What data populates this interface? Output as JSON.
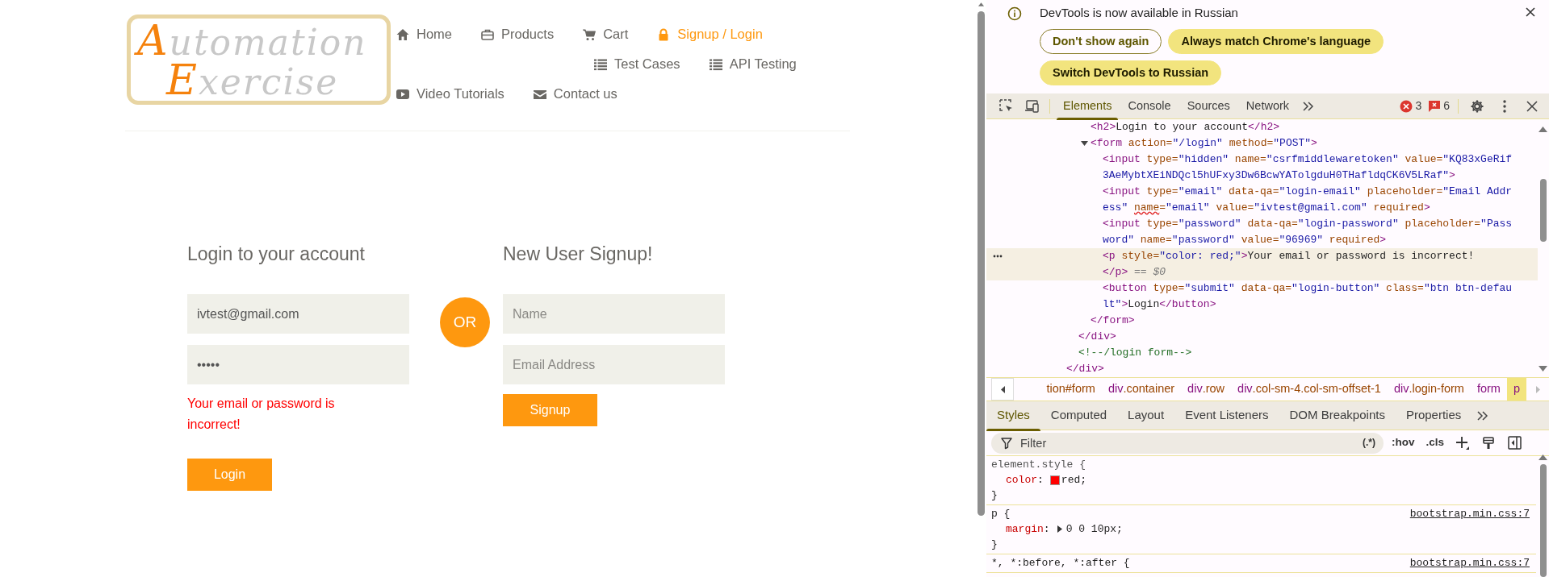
{
  "page": {
    "logo": {
      "line_1": "Automation",
      "line_2": "Exercise"
    },
    "nav": [
      {
        "label": "Home",
        "selected": false
      },
      {
        "label": "Products",
        "selected": false
      },
      {
        "label": "Cart",
        "selected": false
      },
      {
        "label": "Signup / Login",
        "selected": true
      },
      {
        "label": "Test Cases",
        "selected": false
      },
      {
        "label": "API Testing",
        "selected": false
      },
      {
        "label": "Video Tutorials",
        "selected": false
      },
      {
        "label": "Contact us",
        "selected": false
      }
    ],
    "login_form": {
      "title": "Login to your account",
      "fields": [
        {
          "value": "ivtest@gmail.com"
        },
        {
          "value": "•••••"
        }
      ],
      "error": "Your email or password is incorrect!",
      "button": "Login"
    },
    "divider_label": "OR",
    "signup_form": {
      "title": "New User Signup!",
      "fields": [
        {
          "placeholder": "Name"
        },
        {
          "placeholder": "Email Address"
        }
      ],
      "button": "Signup"
    }
  },
  "devtools": {
    "notification": {
      "message": "DevTools is now available in Russian",
      "buttons": [
        {
          "label": "Don't show again",
          "kind": "outline"
        },
        {
          "label": "Always match Chrome's language",
          "kind": "filled"
        },
        {
          "label": "Switch DevTools to Russian",
          "kind": "filled"
        }
      ]
    },
    "tabs": [
      {
        "label": "Elements",
        "selected": true
      },
      {
        "label": "Console",
        "selected": false
      },
      {
        "label": "Sources",
        "selected": false
      },
      {
        "label": "Network",
        "selected": false
      }
    ],
    "counters": {
      "errors": "3",
      "warnings": "6"
    },
    "dom_tree": [
      {
        "closing": [
          {
            "kind": "tag",
            "text": "</div>"
          }
        ],
        "children": [
          {
            "closing": [
              {
                "kind": "tag",
                "text": "</div>"
              }
            ],
            "children": [
              {
                "lines": [
                  [
                    {
                      "kind": "tag",
                      "text": "<h2>"
                    },
                    {
                      "kind": "text",
                      "text": "Login to your account"
                    },
                    {
                      "kind": "tag",
                      "text": "</h2>"
                    }
                  ]
                ]
              },
              {
                "expanded": true,
                "lines": [
                  [
                    {
                      "kind": "tag",
                      "text": "<form"
                    },
                    {
                      "kind": "attr",
                      "text": " action="
                    },
                    {
                      "kind": "value",
                      "text": "\"/login\""
                    },
                    {
                      "kind": "attr",
                      "text": " method="
                    },
                    {
                      "kind": "value",
                      "text": "\"POST\""
                    },
                    {
                      "kind": "tag",
                      "text": ">"
                    }
                  ]
                ],
                "closing": [
                  {
                    "kind": "tag",
                    "text": "</form>"
                  }
                ],
                "children": [
                  {
                    "lines": [
                      [
                        {
                          "kind": "tag",
                          "text": "<input"
                        },
                        {
                          "kind": "attr",
                          "text": " type="
                        },
                        {
                          "kind": "value",
                          "text": "\"hidden\""
                        },
                        {
                          "kind": "attr",
                          "text": " name="
                        },
                        {
                          "kind": "value",
                          "text": "\"csrfmiddlewaretoken\""
                        },
                        {
                          "kind": "attr",
                          "text": " value="
                        },
                        {
                          "kind": "value",
                          "text": "\"KQ83xGeRif"
                        }
                      ],
                      [
                        {
                          "kind": "value",
                          "text": "3AeMybtXEiNDQcl5hUFxy3Dw6BcwYATolgduH0THafldqCK6V5LRaf\""
                        },
                        {
                          "kind": "tag",
                          "text": ">"
                        }
                      ]
                    ]
                  },
                  {
                    "lines": [
                      [
                        {
                          "kind": "tag",
                          "text": "<input"
                        },
                        {
                          "kind": "attr",
                          "text": " type="
                        },
                        {
                          "kind": "value",
                          "text": "\"email\""
                        },
                        {
                          "kind": "attr",
                          "text": " data-qa="
                        },
                        {
                          "kind": "value",
                          "text": "\"login-email\""
                        },
                        {
                          "kind": "attr",
                          "text": " placeholder="
                        },
                        {
                          "kind": "value",
                          "text": "\"Email Addr"
                        }
                      ],
                      [
                        {
                          "kind": "value",
                          "text": "ess\" "
                        },
                        {
                          "kind": "flagged",
                          "text": "name"
                        },
                        {
                          "kind": "attr",
                          "text": "="
                        },
                        {
                          "kind": "value",
                          "text": "\"email\""
                        },
                        {
                          "kind": "attr",
                          "text": " value="
                        },
                        {
                          "kind": "value",
                          "text": "\"ivtest@gmail.com\""
                        },
                        {
                          "kind": "attr",
                          "text": " required"
                        },
                        {
                          "kind": "tag",
                          "text": ">"
                        }
                      ]
                    ]
                  },
                  {
                    "lines": [
                      [
                        {
                          "kind": "tag",
                          "text": "<input"
                        },
                        {
                          "kind": "attr",
                          "text": " type="
                        },
                        {
                          "kind": "value",
                          "text": "\"password\""
                        },
                        {
                          "kind": "attr",
                          "text": " data-qa="
                        },
                        {
                          "kind": "value",
                          "text": "\"login-password\""
                        },
                        {
                          "kind": "attr",
                          "text": " placeholder="
                        },
                        {
                          "kind": "value",
                          "text": "\"Pass"
                        }
                      ],
                      [
                        {
                          "kind": "value",
                          "text": "word\""
                        },
                        {
                          "kind": "attr",
                          "text": " name="
                        },
                        {
                          "kind": "value",
                          "text": "\"password\""
                        },
                        {
                          "kind": "attr",
                          "text": " value="
                        },
                        {
                          "kind": "value",
                          "text": "\"96969\""
                        },
                        {
                          "kind": "attr",
                          "text": " required"
                        },
                        {
                          "kind": "tag",
                          "text": ">"
                        }
                      ]
                    ]
                  },
                  {
                    "selected": true,
                    "lines": [
                      [
                        {
                          "kind": "tag",
                          "text": "<p"
                        },
                        {
                          "kind": "attr",
                          "text": " style="
                        },
                        {
                          "kind": "value",
                          "text": "\"color: red;\""
                        },
                        {
                          "kind": "tag",
                          "text": ">"
                        },
                        {
                          "kind": "text",
                          "text": "Your email or password is incorrect!"
                        }
                      ],
                      [
                        {
                          "kind": "tag",
                          "text": "</p>"
                        },
                        {
                          "kind": "hint",
                          "text": " == $0"
                        }
                      ]
                    ]
                  },
                  {
                    "lines": [
                      [
                        {
                          "kind": "tag",
                          "text": "<button"
                        },
                        {
                          "kind": "attr",
                          "text": " type="
                        },
                        {
                          "kind": "value",
                          "text": "\"submit\""
                        },
                        {
                          "kind": "attr",
                          "text": " data-qa="
                        },
                        {
                          "kind": "value",
                          "text": "\"login-button\""
                        },
                        {
                          "kind": "attr",
                          "text": " class="
                        },
                        {
                          "kind": "value",
                          "text": "\"btn btn-defau"
                        }
                      ],
                      [
                        {
                          "kind": "value",
                          "text": "lt\""
                        },
                        {
                          "kind": "tag",
                          "text": ">"
                        },
                        {
                          "kind": "text",
                          "text": "Login"
                        },
                        {
                          "kind": "tag",
                          "text": "</button>"
                        }
                      ]
                    ]
                  }
                ]
              }
            ]
          },
          {
            "lines": [
              [
                {
                  "kind": "comment",
                  "text": "<!--/login form-->"
                }
              ]
            ]
          }
        ]
      }
    ],
    "breadcrumbs": [
      {
        "detail": "tion#form",
        "selected": false
      },
      {
        "tag": "div",
        "detail": ".container",
        "selected": false
      },
      {
        "tag": "div",
        "detail": ".row",
        "selected": false
      },
      {
        "tag": "div",
        "detail": ".col-sm-4.col-sm-offset-1",
        "selected": false
      },
      {
        "tag": "div",
        "detail": ".login-form",
        "selected": false
      },
      {
        "tag": "form",
        "selected": false
      },
      {
        "tag": "p",
        "selected": true
      }
    ],
    "sidebar_tabs": [
      {
        "label": "Styles",
        "selected": true
      },
      {
        "label": "Computed",
        "selected": false
      },
      {
        "label": "Layout",
        "selected": false
      },
      {
        "label": "Event Listeners",
        "selected": false
      },
      {
        "label": "DOM Breakpoints",
        "selected": false
      },
      {
        "label": "Properties",
        "selected": false
      }
    ],
    "filter": {
      "placeholder": "Filter",
      "regex": "(.*)",
      "buttons": [
        ":hov",
        ".cls"
      ]
    },
    "rules": [
      {
        "selector": "element.style {",
        "inline": true,
        "declarations": [
          {
            "property": "color",
            "colon": ":",
            "value": "red;",
            "color": "#ff0000"
          }
        ],
        "closing": "}"
      },
      {
        "selector": "p {",
        "inline": false,
        "source": "bootstrap.min.css:7",
        "declarations": [
          {
            "property": "margin",
            "colon": ":",
            "value": "0 0 10px;",
            "expandable": true
          }
        ],
        "closing": "}"
      },
      {
        "selector": "*, *:before, *:after {",
        "inline": false,
        "source": "bootstrap.min.css:7"
      }
    ]
  }
}
